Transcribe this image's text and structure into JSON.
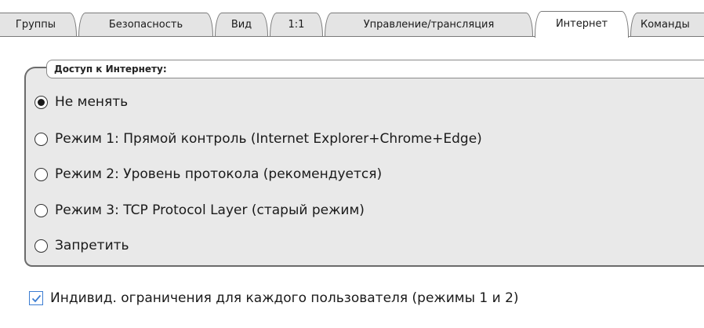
{
  "tabs": [
    {
      "label": "Группы",
      "active": false
    },
    {
      "label": "Безопасность",
      "active": false
    },
    {
      "label": "Вид",
      "active": false
    },
    {
      "label": "1:1",
      "active": false
    },
    {
      "label": "Управление/трансляция",
      "active": false
    },
    {
      "label": "Интернет",
      "active": true
    },
    {
      "label": "Команды",
      "active": false
    }
  ],
  "internet_access": {
    "legend": "Доступ к Интернету:",
    "options": [
      {
        "label": "Не менять",
        "selected": true
      },
      {
        "label": "Режим 1: Прямой контроль (Internet Explorer+Chrome+Edge)",
        "selected": false
      },
      {
        "label": "Режим 2: Уровень протокола (рекомендуется)",
        "selected": false
      },
      {
        "label": "Режим 3: TCP Protocol Layer (старый режим)",
        "selected": false
      },
      {
        "label": "Запретить",
        "selected": false
      }
    ]
  },
  "per_user_limits": {
    "label": "Индивид. ограничения для каждого пользователя (режимы 1 и 2)",
    "checked": true
  },
  "colors": {
    "checkbox_accent": "#3c7dd2",
    "group_background": "#e9e9e9"
  }
}
